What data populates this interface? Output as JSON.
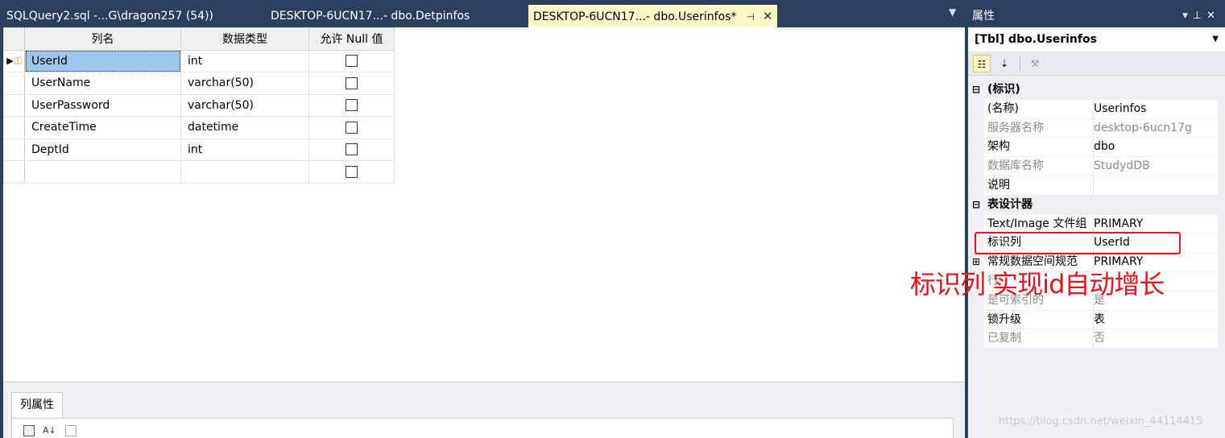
{
  "tabs": [
    {
      "label": "SQLQuery2.sql -...G\\dragon257 (54))"
    },
    {
      "label": "DESKTOP-6UCN17...- dbo.Detpinfos"
    },
    {
      "label": "DESKTOP-6UCN17...- dbo.Userinfos*"
    }
  ],
  "grid": {
    "headers": [
      "列名",
      "数据类型",
      "允许 Null 值"
    ],
    "rows": [
      {
        "name": "UserId",
        "type": "int",
        "nullable": false,
        "primary_key": true
      },
      {
        "name": "UserName",
        "type": "varchar(50)",
        "nullable": false
      },
      {
        "name": "UserPassword",
        "type": "varchar(50)",
        "nullable": false
      },
      {
        "name": "CreateTime",
        "type": "datetime",
        "nullable": false
      },
      {
        "name": "DeptId",
        "type": "int",
        "nullable": false
      },
      {
        "name": "",
        "type": "",
        "nullable": false
      }
    ]
  },
  "column_properties": {
    "tab_label": "列属性"
  },
  "properties": {
    "title": "属性",
    "object": "[Tbl] dbo.Userinfos",
    "categories": [
      {
        "label": "(标识)",
        "rows": [
          {
            "key": "(名称)",
            "value": "Userinfos",
            "dim": false
          },
          {
            "key": "服务器名称",
            "value": "desktop-6ucn17g",
            "dim": true
          },
          {
            "key": "架构",
            "value": "dbo",
            "dim": false
          },
          {
            "key": "数据库名称",
            "value": "StudydDB",
            "dim": true
          },
          {
            "key": "说明",
            "value": "",
            "dim": false
          }
        ]
      },
      {
        "label": "表设计器",
        "rows": [
          {
            "key": "Text/Image 文件组",
            "value": "PRIMARY",
            "dim": false
          },
          {
            "key": "标识列",
            "value": "UserId",
            "dim": false
          },
          {
            "key": "常规数据空间规范",
            "value": "PRIMARY",
            "dim": false,
            "expandable": true
          },
          {
            "key": "行",
            "value": "",
            "dim": true
          },
          {
            "key": "是可索引的",
            "value": "是",
            "dim": true
          },
          {
            "key": "锁升级",
            "value": "表",
            "dim": false
          },
          {
            "key": "已复制",
            "value": "否",
            "dim": true
          }
        ]
      }
    ]
  },
  "annotation": "标识列 实现id自动增长",
  "watermark": "https://blog.csdn.net/weixin_44114415",
  "colors": {
    "annotation": "#e8141b",
    "active_tab": "#fff8c8",
    "frame": "#2b3f5e",
    "selected_cell": "#9ec5ec"
  }
}
